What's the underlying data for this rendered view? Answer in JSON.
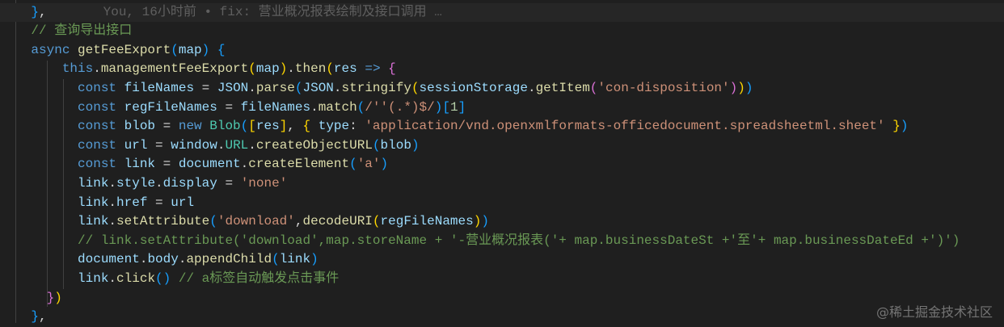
{
  "editor": {
    "blame": "You, 16小时前 • fix: 营业概况报表绘制及接口调用 …",
    "lines": [
      {
        "indent": "    ",
        "tokens": [
          [
            "}",
            "b1"
          ]
        ]
      },
      {
        "indent": "    ",
        "tokens": [
          [
            "}",
            "b3"
          ],
          [
            ",",
            "op"
          ]
        ],
        "blame": true
      },
      {
        "indent": "    ",
        "tokens": [
          [
            "// 查询导出接口",
            "cmt"
          ]
        ]
      },
      {
        "indent": "    ",
        "tokens": [
          [
            "async ",
            "kw"
          ],
          [
            "getFeeExport",
            "fn"
          ],
          [
            "(",
            "b3"
          ],
          [
            "map",
            "var"
          ],
          [
            ")",
            "b3"
          ],
          [
            " ",
            "op"
          ],
          [
            "{",
            "b3"
          ]
        ]
      },
      {
        "indent": "        ",
        "tokens": [
          [
            "this",
            "kw"
          ],
          [
            ".",
            "op"
          ],
          [
            "managementFeeExport",
            "fn"
          ],
          [
            "(",
            "b1"
          ],
          [
            "map",
            "var"
          ],
          [
            ")",
            "b1"
          ],
          [
            ".",
            "op"
          ],
          [
            "then",
            "fn"
          ],
          [
            "(",
            "b1"
          ],
          [
            "res",
            "var"
          ],
          [
            " ",
            "op"
          ],
          [
            "=>",
            "kw"
          ],
          [
            " ",
            "op"
          ],
          [
            "{",
            "b2"
          ]
        ]
      },
      {
        "indent": "          ",
        "tokens": [
          [
            "const ",
            "kw"
          ],
          [
            "fileNames",
            "var"
          ],
          [
            " = ",
            "op"
          ],
          [
            "JSON",
            "var"
          ],
          [
            ".",
            "op"
          ],
          [
            "parse",
            "fn"
          ],
          [
            "(",
            "b3"
          ],
          [
            "JSON",
            "var"
          ],
          [
            ".",
            "op"
          ],
          [
            "stringify",
            "fn"
          ],
          [
            "(",
            "b1"
          ],
          [
            "sessionStorage",
            "var"
          ],
          [
            ".",
            "op"
          ],
          [
            "getItem",
            "fn"
          ],
          [
            "(",
            "b2"
          ],
          [
            "'con-disposition'",
            "str"
          ],
          [
            ")",
            "b2"
          ],
          [
            ")",
            "b1"
          ],
          [
            ")",
            "b3"
          ]
        ]
      },
      {
        "indent": "          ",
        "tokens": [
          [
            "const ",
            "kw"
          ],
          [
            "regFileNames",
            "var"
          ],
          [
            " = ",
            "op"
          ],
          [
            "fileNames",
            "var"
          ],
          [
            ".",
            "op"
          ],
          [
            "match",
            "fn"
          ],
          [
            "(",
            "b3"
          ],
          [
            "/''(.*)$/",
            "str"
          ],
          [
            ")",
            "b3"
          ],
          [
            "[",
            "b3"
          ],
          [
            "1",
            "num"
          ],
          [
            "]",
            "b3"
          ]
        ]
      },
      {
        "indent": "          ",
        "tokens": [
          [
            "const ",
            "kw"
          ],
          [
            "blob",
            "var"
          ],
          [
            " = ",
            "op"
          ],
          [
            "new ",
            "kw"
          ],
          [
            "Blob",
            "cls"
          ],
          [
            "(",
            "b3"
          ],
          [
            "[",
            "b1"
          ],
          [
            "res",
            "var"
          ],
          [
            "]",
            "b1"
          ],
          [
            ", ",
            "op"
          ],
          [
            "{",
            "b1"
          ],
          [
            " type",
            "var"
          ],
          [
            ": ",
            "op"
          ],
          [
            "'application/vnd.openxmlformats-officedocument.spreadsheetml.sheet'",
            "str"
          ],
          [
            " ",
            "op"
          ],
          [
            "}",
            "b1"
          ],
          [
            ")",
            "b3"
          ]
        ]
      },
      {
        "indent": "          ",
        "tokens": [
          [
            "const ",
            "kw"
          ],
          [
            "url",
            "var"
          ],
          [
            " = ",
            "op"
          ],
          [
            "window",
            "var"
          ],
          [
            ".",
            "op"
          ],
          [
            "URL",
            "cls"
          ],
          [
            ".",
            "op"
          ],
          [
            "createObjectURL",
            "fn"
          ],
          [
            "(",
            "b3"
          ],
          [
            "blob",
            "var"
          ],
          [
            ")",
            "b3"
          ]
        ]
      },
      {
        "indent": "          ",
        "tokens": [
          [
            "const ",
            "kw"
          ],
          [
            "link",
            "var"
          ],
          [
            " = ",
            "op"
          ],
          [
            "document",
            "var"
          ],
          [
            ".",
            "op"
          ],
          [
            "createElement",
            "fn"
          ],
          [
            "(",
            "b3"
          ],
          [
            "'a'",
            "str"
          ],
          [
            ")",
            "b3"
          ]
        ]
      },
      {
        "indent": "          ",
        "tokens": [
          [
            "link",
            "var"
          ],
          [
            ".",
            "op"
          ],
          [
            "style",
            "var"
          ],
          [
            ".",
            "op"
          ],
          [
            "display",
            "var"
          ],
          [
            " = ",
            "op"
          ],
          [
            "'none'",
            "str"
          ]
        ]
      },
      {
        "indent": "          ",
        "tokens": [
          [
            "link",
            "var"
          ],
          [
            ".",
            "op"
          ],
          [
            "href",
            "var"
          ],
          [
            " = ",
            "op"
          ],
          [
            "url",
            "var"
          ]
        ]
      },
      {
        "indent": "          ",
        "tokens": [
          [
            "link",
            "var"
          ],
          [
            ".",
            "op"
          ],
          [
            "setAttribute",
            "fn"
          ],
          [
            "(",
            "b3"
          ],
          [
            "'download'",
            "str"
          ],
          [
            ",",
            "op"
          ],
          [
            "decodeURI",
            "fn"
          ],
          [
            "(",
            "b1"
          ],
          [
            "regFileNames",
            "var"
          ],
          [
            ")",
            "b1"
          ],
          [
            ")",
            "b3"
          ]
        ]
      },
      {
        "indent": "          ",
        "tokens": [
          [
            "// link.setAttribute('download',map.storeName + '-营业概况报表('+ map.businessDateSt +'至'+ map.businessDateEd +')')",
            "cmt"
          ]
        ]
      },
      {
        "indent": "          ",
        "tokens": [
          [
            "document",
            "var"
          ],
          [
            ".",
            "op"
          ],
          [
            "body",
            "var"
          ],
          [
            ".",
            "op"
          ],
          [
            "appendChild",
            "fn"
          ],
          [
            "(",
            "b3"
          ],
          [
            "link",
            "var"
          ],
          [
            ")",
            "b3"
          ]
        ]
      },
      {
        "indent": "          ",
        "tokens": [
          [
            "link",
            "var"
          ],
          [
            ".",
            "op"
          ],
          [
            "click",
            "fn"
          ],
          [
            "()",
            "b3"
          ],
          [
            " ",
            "op"
          ],
          [
            "// a标签自动触发点击事件",
            "cmt"
          ]
        ]
      },
      {
        "indent": "      ",
        "tokens": [
          [
            "}",
            "b2"
          ],
          [
            ")",
            "b1"
          ]
        ]
      },
      {
        "indent": "    ",
        "tokens": [
          [
            "}",
            "b3"
          ],
          [
            ",",
            "op"
          ]
        ]
      }
    ]
  },
  "watermark": "@稀土掘金技术社区"
}
